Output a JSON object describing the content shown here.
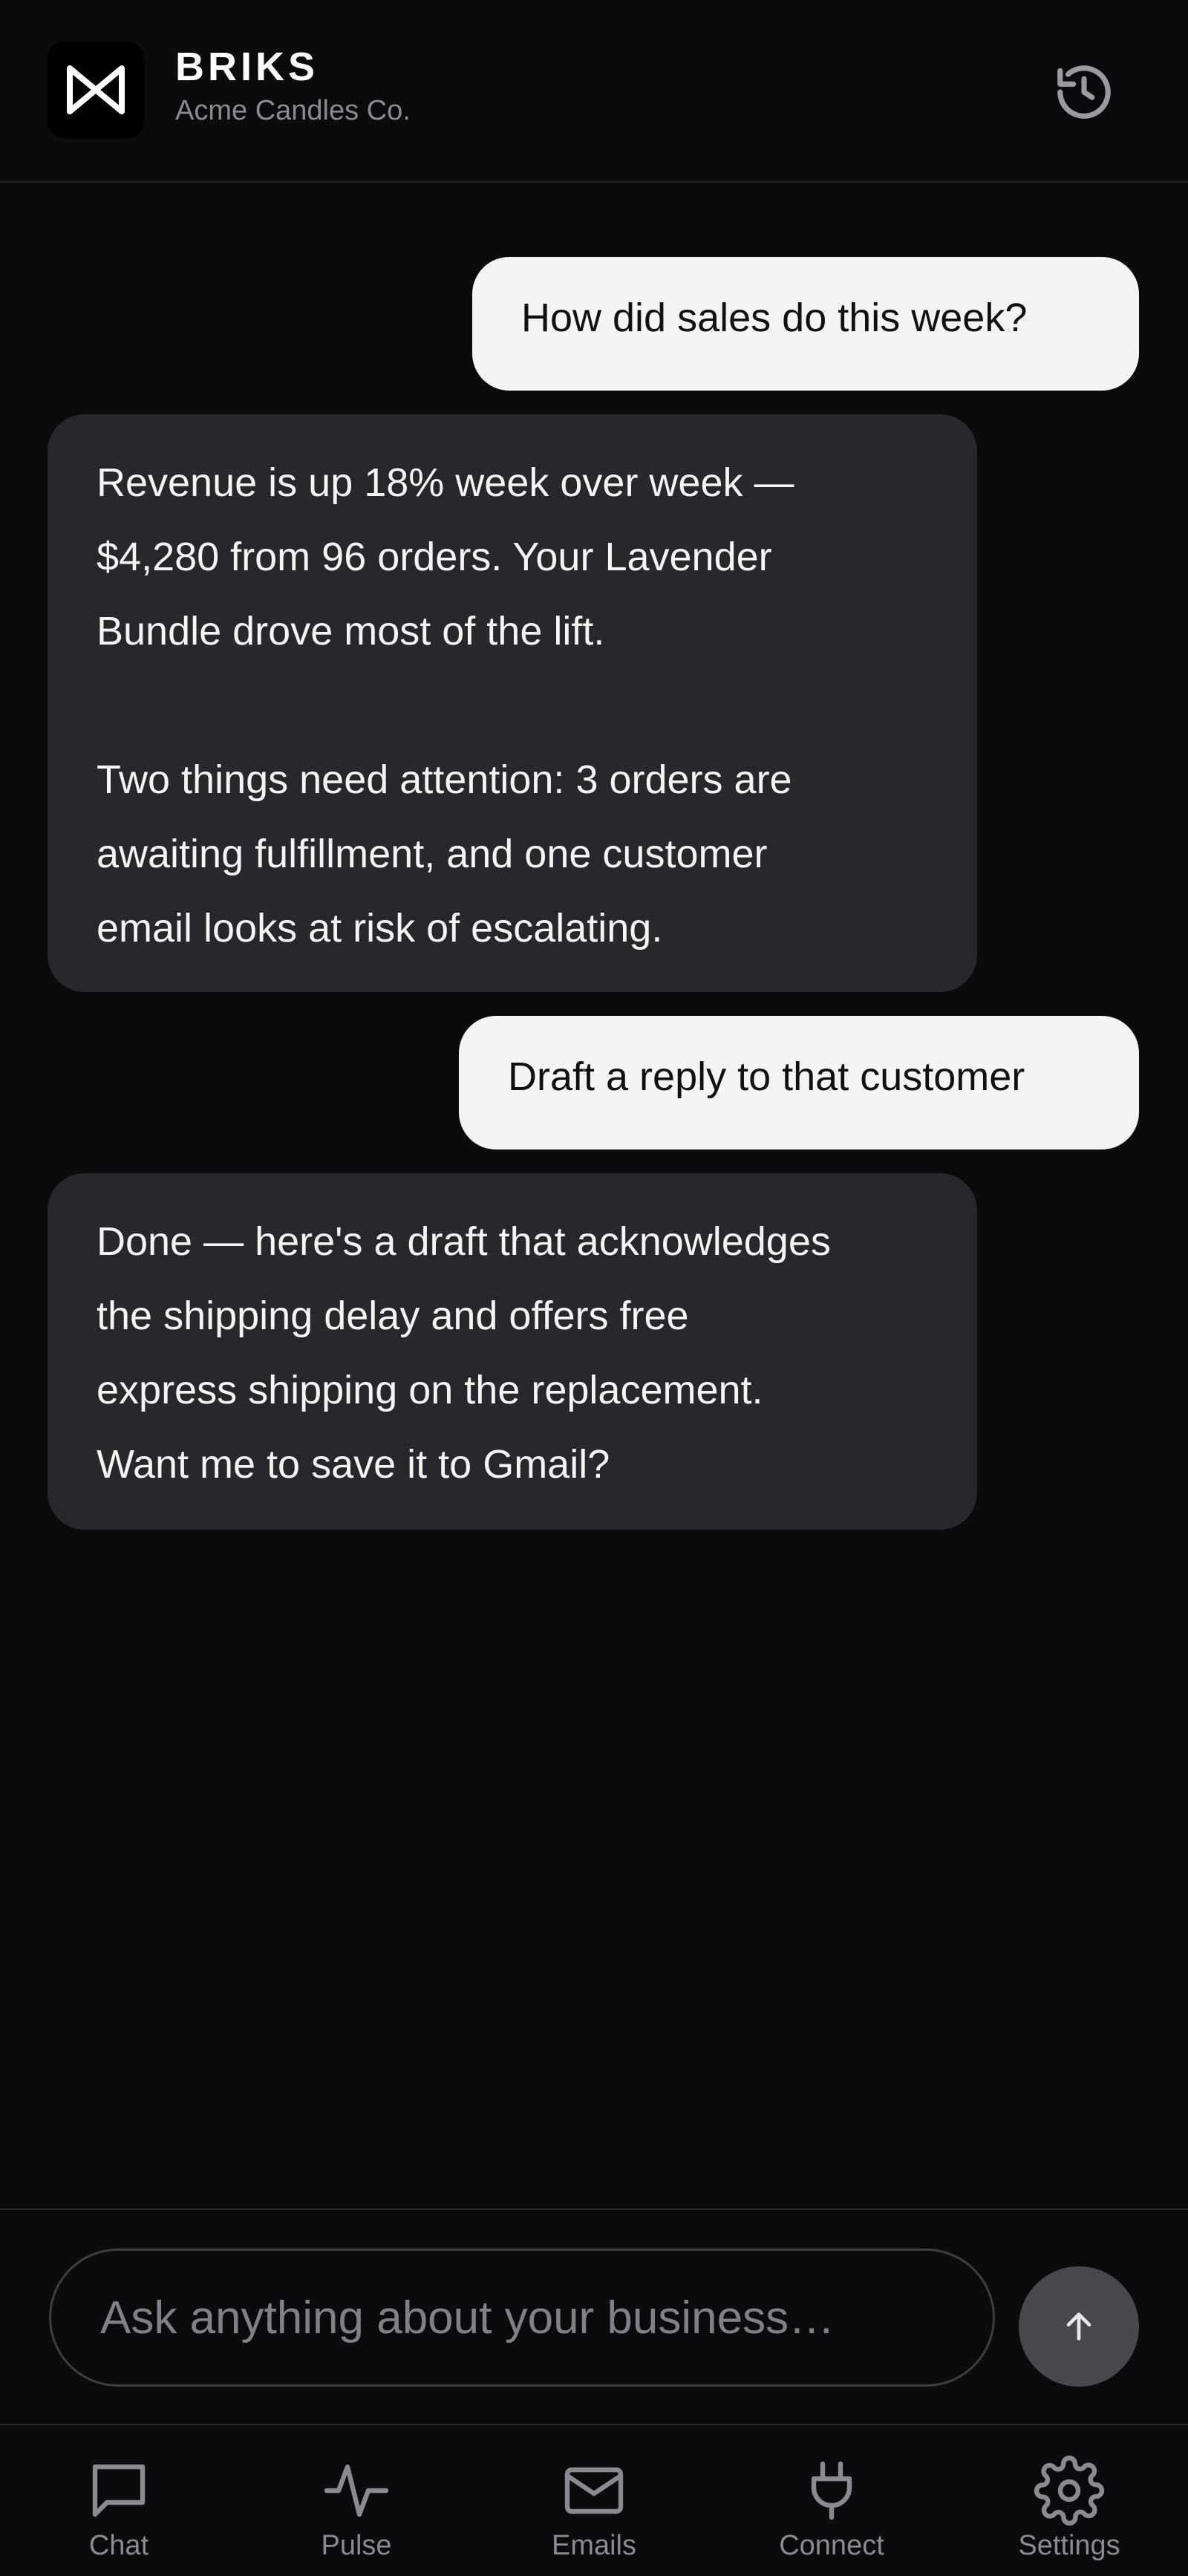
{
  "header": {
    "brand_name": "BRIKS",
    "company": "Acme Candles Co.",
    "logo_icon": "briks-logo",
    "history_icon": "history-icon"
  },
  "messages": [
    {
      "role": "user",
      "text": "How did sales do this week?"
    },
    {
      "role": "assistant",
      "text": "Revenue is up 18% week over week —\n$4,280 from 96 orders. Your Lavender\nBundle drove most of the lift.\n\nTwo things need attention: 3 orders are\nawaiting fulfillment, and one customer\nemail looks at risk of escalating."
    },
    {
      "role": "user",
      "text": "Draft a reply to that customer"
    },
    {
      "role": "assistant",
      "text": "Done — here's a draft that acknowledges\nthe shipping delay and offers free\nexpress shipping on the replacement.\nWant me to save it to Gmail?"
    }
  ],
  "composer": {
    "placeholder": "Ask anything about your business…",
    "value": "",
    "send_icon": "arrow-up-icon"
  },
  "tabs": [
    {
      "label": "Chat",
      "icon": "chat-icon"
    },
    {
      "label": "Pulse",
      "icon": "pulse-icon"
    },
    {
      "label": "Emails",
      "icon": "mail-icon"
    },
    {
      "label": "Connect",
      "icon": "plug-icon"
    },
    {
      "label": "Settings",
      "icon": "gear-icon"
    }
  ],
  "colors": {
    "background": "#0b0b0d",
    "user_bubble": "#f4f4f4",
    "assistant_bubble": "#28282c",
    "muted_text": "#8a8a90"
  }
}
